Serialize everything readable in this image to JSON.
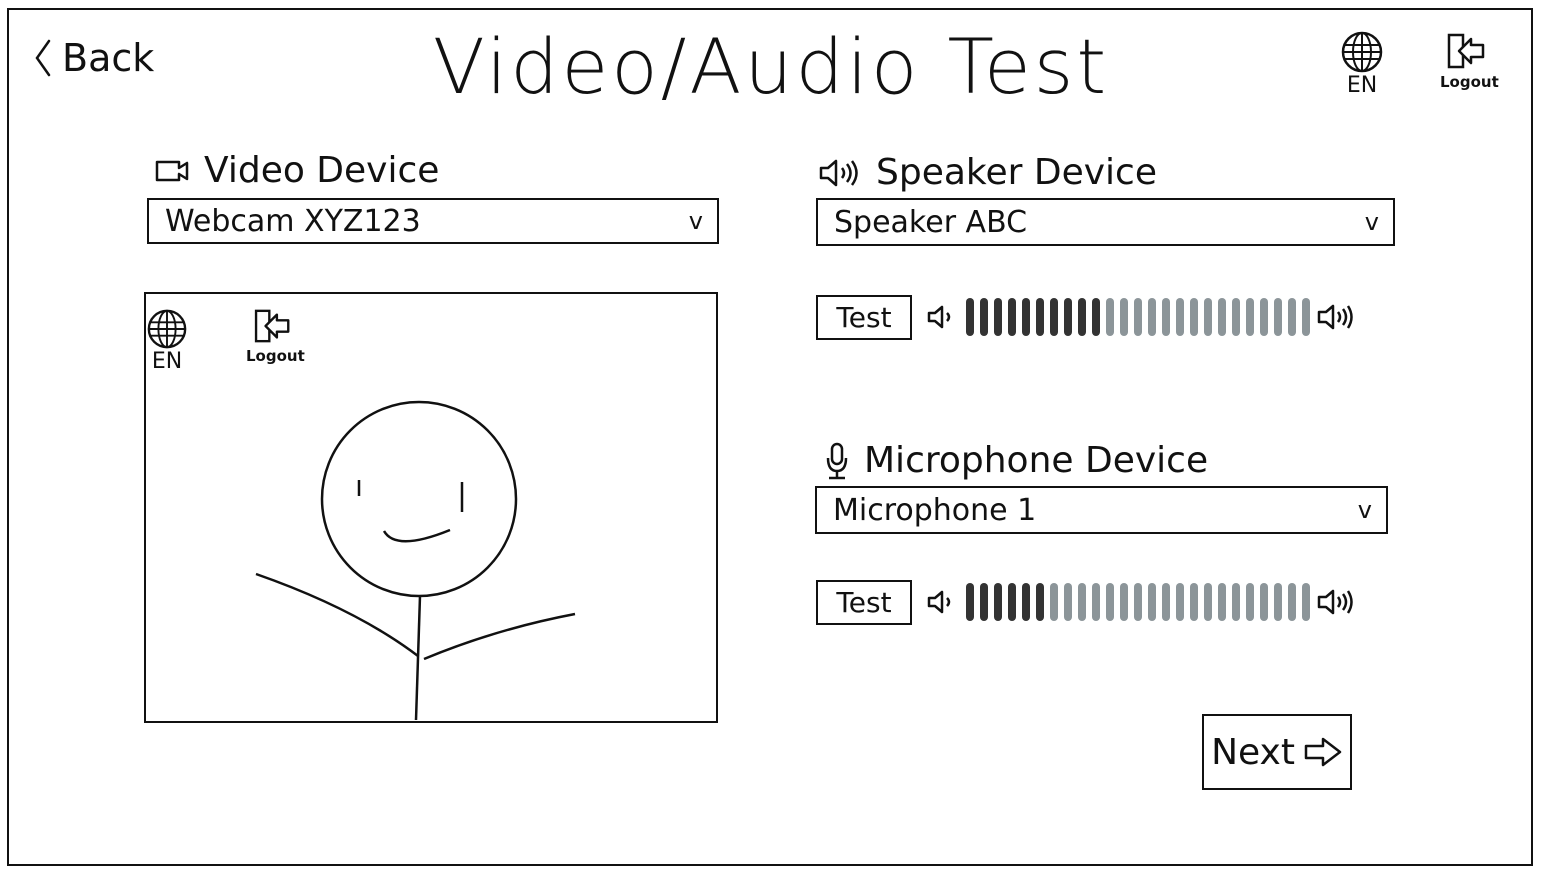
{
  "header": {
    "back_label": "Back",
    "title": "Video/Audio Test",
    "language_label": "EN",
    "logout_label": "Logout"
  },
  "video": {
    "label": "Video Device",
    "selected": "Webcam XYZ123",
    "overlay_language_label": "EN",
    "overlay_logout_label": "Logout"
  },
  "speaker": {
    "label": "Speaker Device",
    "selected": "Speaker ABC",
    "test_label": "Test",
    "level_active": 10,
    "level_total": 25
  },
  "microphone": {
    "label": "Microphone Device",
    "selected": "Microphone 1",
    "test_label": "Test",
    "level_active": 6,
    "level_total": 25
  },
  "footer": {
    "next_label": "Next"
  },
  "colors": {
    "active_bar": "#333333",
    "inactive_bar": "#8c9599",
    "ink": "#111111"
  },
  "icons": {
    "back": "chevron-left-icon",
    "language": "globe-icon",
    "logout": "logout-icon",
    "camera": "camera-icon",
    "speaker": "speaker-icon",
    "microphone": "microphone-icon",
    "volume_low": "volume-low-icon",
    "volume_high": "volume-high-icon",
    "next": "arrow-right-icon",
    "dropdown": "chevron-down-icon"
  }
}
